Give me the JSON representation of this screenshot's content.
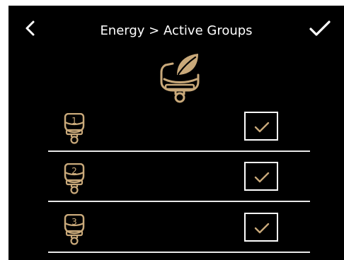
{
  "header": {
    "title": "Energy > Active Groups",
    "back_icon": "chevron-left-icon",
    "confirm_icon": "checkmark-icon"
  },
  "energy_icon": "energy-leaf-group-icon",
  "groups": [
    {
      "number": "1",
      "checked": true
    },
    {
      "number": "2",
      "checked": true
    },
    {
      "number": "3",
      "checked": true
    }
  ],
  "colors": {
    "background": "#000000",
    "accent_gold": "#c9a97a",
    "foreground": "#ffffff"
  }
}
